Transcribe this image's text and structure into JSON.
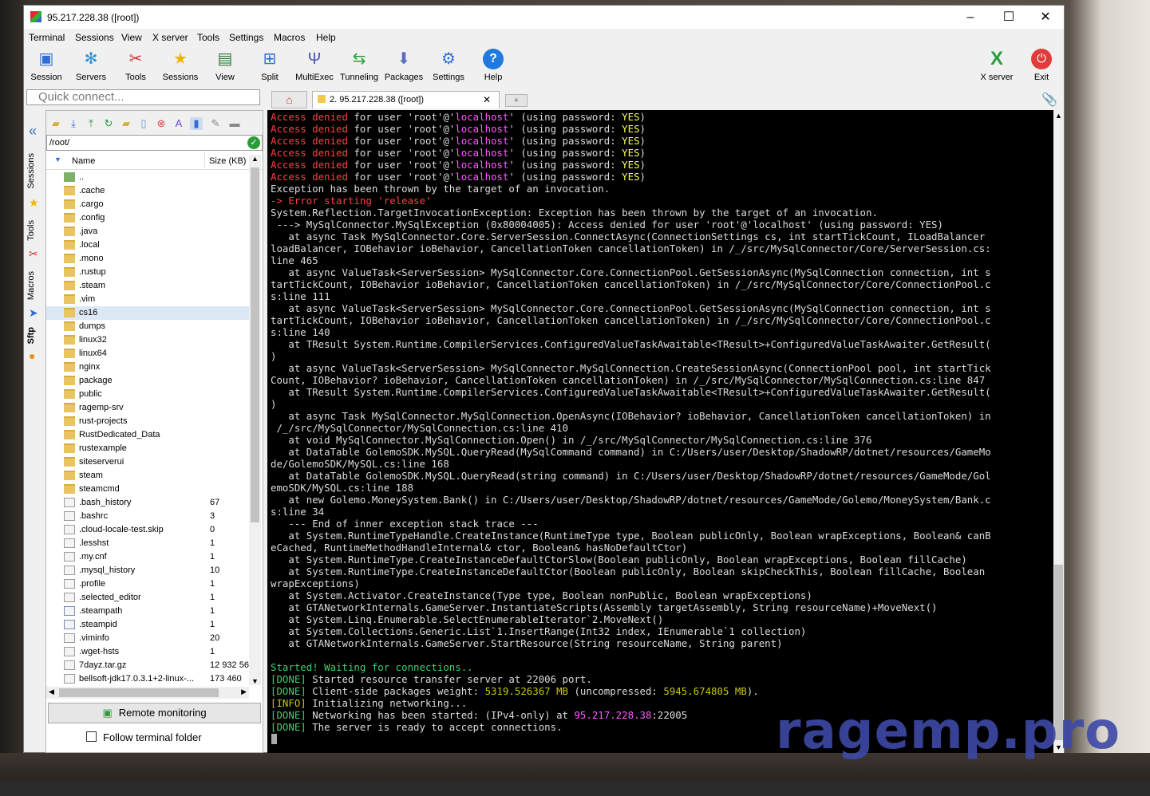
{
  "window": {
    "title": "95.217.228.38 ([root])",
    "minimize": "–",
    "maximize": "☐",
    "close": "✕"
  },
  "menu": [
    "Terminal",
    "Sessions",
    "View",
    "X server",
    "Tools",
    "Settings",
    "Macros",
    "Help"
  ],
  "toolbar": [
    {
      "label": "Session",
      "icon": "session-icon"
    },
    {
      "label": "Servers",
      "icon": "servers-icon"
    },
    {
      "label": "Tools",
      "icon": "tools-icon"
    },
    {
      "label": "Sessions",
      "icon": "star-icon"
    },
    {
      "label": "View",
      "icon": "view-icon"
    },
    {
      "label": "Split",
      "icon": "split-icon"
    },
    {
      "label": "MultiExec",
      "icon": "multiexec-icon"
    },
    {
      "label": "Tunneling",
      "icon": "tunneling-icon"
    },
    {
      "label": "Packages",
      "icon": "packages-icon"
    },
    {
      "label": "Settings",
      "icon": "gear-icon"
    },
    {
      "label": "Help",
      "icon": "help-icon"
    }
  ],
  "toolbar_right": [
    {
      "label": "X server",
      "icon": "x-server-icon"
    },
    {
      "label": "Exit",
      "icon": "power-icon"
    }
  ],
  "quick_connect": {
    "placeholder": "Quick connect..."
  },
  "tabs": {
    "session_label": "2. 95.217.228.38 ([root])",
    "close": "✕"
  },
  "sidebar_tabs": [
    "Sessions",
    "Tools",
    "Macros",
    "Sftp"
  ],
  "sftp": {
    "path": "/root/",
    "col_name": "Name",
    "col_size": "Size (KB)",
    "files": [
      {
        "name": "..",
        "size": "",
        "type": "up"
      },
      {
        "name": ".cache",
        "size": "",
        "type": "folder"
      },
      {
        "name": ".cargo",
        "size": "",
        "type": "folder"
      },
      {
        "name": ".config",
        "size": "",
        "type": "folder"
      },
      {
        "name": ".java",
        "size": "",
        "type": "folder"
      },
      {
        "name": ".local",
        "size": "",
        "type": "folder"
      },
      {
        "name": ".mono",
        "size": "",
        "type": "folder"
      },
      {
        "name": ".rustup",
        "size": "",
        "type": "folder"
      },
      {
        "name": ".steam",
        "size": "",
        "type": "folder"
      },
      {
        "name": ".vim",
        "size": "",
        "type": "folder"
      },
      {
        "name": "cs16",
        "size": "",
        "type": "folder"
      },
      {
        "name": "dumps",
        "size": "",
        "type": "folder"
      },
      {
        "name": "linux32",
        "size": "",
        "type": "folder"
      },
      {
        "name": "linux64",
        "size": "",
        "type": "folder"
      },
      {
        "name": "nginx",
        "size": "",
        "type": "folder"
      },
      {
        "name": "package",
        "size": "",
        "type": "folder"
      },
      {
        "name": "public",
        "size": "",
        "type": "folder"
      },
      {
        "name": "ragemp-srv",
        "size": "",
        "type": "folder"
      },
      {
        "name": "rust-projects",
        "size": "",
        "type": "folder"
      },
      {
        "name": "RustDedicated_Data",
        "size": "",
        "type": "folder"
      },
      {
        "name": "rustexample",
        "size": "",
        "type": "folder"
      },
      {
        "name": "siteserverui",
        "size": "",
        "type": "folder"
      },
      {
        "name": "steam",
        "size": "",
        "type": "folder"
      },
      {
        "name": "steamcmd",
        "size": "",
        "type": "folder"
      },
      {
        "name": ".bash_history",
        "size": "67",
        "type": "file"
      },
      {
        "name": ".bashrc",
        "size": "3",
        "type": "file"
      },
      {
        "name": ".cloud-locale-test.skip",
        "size": "0",
        "type": "file"
      },
      {
        "name": ".lesshst",
        "size": "1",
        "type": "file"
      },
      {
        "name": ".my.cnf",
        "size": "1",
        "type": "file"
      },
      {
        "name": ".mysql_history",
        "size": "10",
        "type": "file"
      },
      {
        "name": ".profile",
        "size": "1",
        "type": "file"
      },
      {
        "name": ".selected_editor",
        "size": "1",
        "type": "file"
      },
      {
        "name": ".steampath",
        "size": "1",
        "type": "link"
      },
      {
        "name": ".steampid",
        "size": "1",
        "type": "link"
      },
      {
        "name": ".viminfo",
        "size": "20",
        "type": "file"
      },
      {
        "name": ".wget-hsts",
        "size": "1",
        "type": "file"
      },
      {
        "name": "7dayz.tar.gz",
        "size": "12 932 56",
        "type": "file"
      },
      {
        "name": "bellsoft-jdk17.0.3.1+2-linux-...",
        "size": "173 460",
        "type": "file"
      }
    ],
    "selected": "cs16",
    "remote_monitoring": "Remote monitoring",
    "follow_terminal": "Follow terminal folder"
  },
  "terminal": {
    "denied": {
      "a": "Access denied",
      "b": " for user 'root'@'",
      "host": "localhost",
      "c": "' (using password: ",
      "yes": "YES",
      "d": ")"
    },
    "lines": [
      "Exception has been thrown by the target of an invocation.",
      "System.Reflection.TargetInvocationException: Exception has been thrown by the target of an invocation.",
      " ---> MySqlConnector.MySqlException (0x80004005): Access denied for user 'root'@'localhost' (using password: YES)",
      "   at async Task MySqlConnector.Core.ServerSession.ConnectAsync(ConnectionSettings cs, int startTickCount, ILoadBalancer",
      "loadBalancer, IOBehavior ioBehavior, CancellationToken cancellationToken) in /_/src/MySqlConnector/Core/ServerSession.cs:",
      "line 465",
      "   at async ValueTask<ServerSession> MySqlConnector.Core.ConnectionPool.GetSessionAsync(MySqlConnection connection, int s",
      "tartTickCount, IOBehavior ioBehavior, CancellationToken cancellationToken) in /_/src/MySqlConnector/Core/ConnectionPool.c",
      "s:line 111",
      "   at async ValueTask<ServerSession> MySqlConnector.Core.ConnectionPool.GetSessionAsync(MySqlConnection connection, int s",
      "tartTickCount, IOBehavior ioBehavior, CancellationToken cancellationToken) in /_/src/MySqlConnector/Core/ConnectionPool.c",
      "s:line 140",
      "   at TResult System.Runtime.CompilerServices.ConfiguredValueTaskAwaitable<TResult>+ConfiguredValueTaskAwaiter.GetResult(",
      ")",
      "   at async ValueTask<ServerSession> MySqlConnector.MySqlConnection.CreateSessionAsync(ConnectionPool pool, int startTick",
      "Count, IOBehavior? ioBehavior, CancellationToken cancellationToken) in /_/src/MySqlConnector/MySqlConnection.cs:line 847",
      "   at TResult System.Runtime.CompilerServices.ConfiguredValueTaskAwaitable<TResult>+ConfiguredValueTaskAwaiter.GetResult(",
      ")",
      "   at async Task MySqlConnector.MySqlConnection.OpenAsync(IOBehavior? ioBehavior, CancellationToken cancellationToken) in",
      " /_/src/MySqlConnector/MySqlConnection.cs:line 410",
      "   at void MySqlConnector.MySqlConnection.Open() in /_/src/MySqlConnector/MySqlConnection.cs:line 376",
      "   at DataTable GolemoSDK.MySQL.QueryRead(MySqlCommand command) in C:/Users/user/Desktop/ShadowRP/dotnet/resources/GameMo",
      "de/GolemoSDK/MySQL.cs:line 168",
      "   at DataTable GolemoSDK.MySQL.QueryRead(string command) in C:/Users/user/Desktop/ShadowRP/dotnet/resources/GameMode/Gol",
      "emoSDK/MySQL.cs:line 188",
      "   at new Golemo.MoneySystem.Bank() in C:/Users/user/Desktop/ShadowRP/dotnet/resources/GameMode/Golemo/MoneySystem/Bank.c",
      "s:line 34",
      "   --- End of inner exception stack trace ---",
      "   at System.RuntimeTypeHandle.CreateInstance(RuntimeType type, Boolean publicOnly, Boolean wrapExceptions, Boolean& canB",
      "eCached, RuntimeMethodHandleInternal& ctor, Boolean& hasNoDefaultCtor)",
      "   at System.RuntimeType.CreateInstanceDefaultCtorSlow(Boolean publicOnly, Boolean wrapExceptions, Boolean fillCache)",
      "   at System.RuntimeType.CreateInstanceDefaultCtor(Boolean publicOnly, Boolean skipCheckThis, Boolean fillCache, Boolean",
      "wrapExceptions)",
      "   at System.Activator.CreateInstance(Type type, Boolean nonPublic, Boolean wrapExceptions)",
      "   at GTANetworkInternals.GameServer.InstantiateScripts(Assembly targetAssembly, String resourceName)+MoveNext()",
      "   at System.Linq.Enumerable.SelectEnumerableIterator`2.MoveNext()",
      "   at System.Collections.Generic.List`1.InsertRange(Int32 index, IEnumerable`1 collection)",
      "   at GTANetworkInternals.GameServer.StartResource(String resourceName, String parent)"
    ],
    "error_prefix": "-> ",
    "error_text": "Error starting 'release'",
    "started": "Started! Waiting for connections..",
    "done_tag": "[DONE]",
    "info_tag": "[INFO]",
    "l1": " Started resource transfer server at 22006 port.",
    "l2a": " Client-side packages weight: ",
    "l2b": "5319.526367 MB",
    "l2c": " (uncompressed: ",
    "l2d": "5945.674805 MB",
    "l2e": ").",
    "l3": " Initializing networking...",
    "l4a": " Networking has been started: (IPv4-only) at ",
    "l4b": "95.217.228.38",
    "l4c": ":22005",
    "l5": " The server is ready to accept connections."
  },
  "watermark": "ragemp.pro"
}
